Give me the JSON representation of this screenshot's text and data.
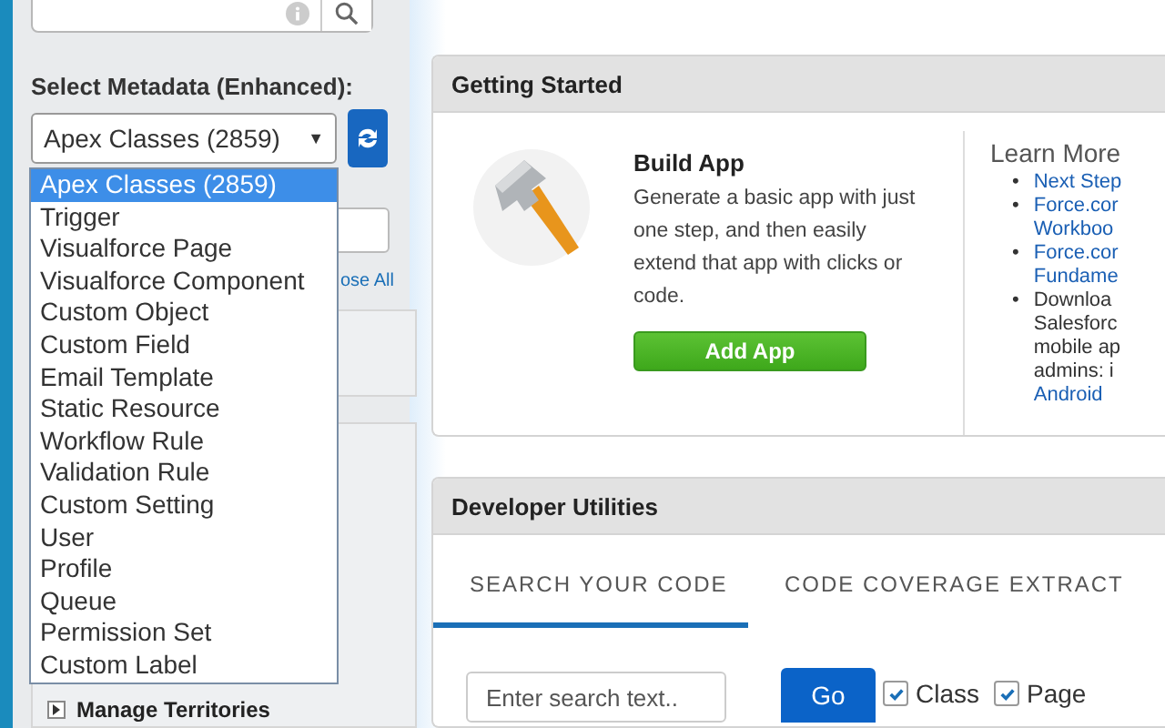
{
  "sidebar": {
    "metadata_label": "Select Metadata (Enhanced):",
    "select": {
      "value": "Apex Classes (2859)",
      "caret": "▼",
      "expanded": true,
      "options": [
        {
          "label": "Apex Classes (2859)",
          "selected": true
        },
        {
          "label": "Trigger",
          "selected": false
        },
        {
          "label": "Visualforce Page",
          "selected": false
        },
        {
          "label": "Visualforce Component",
          "selected": false
        },
        {
          "label": "Custom Object",
          "selected": false
        },
        {
          "label": "Custom Field",
          "selected": false
        },
        {
          "label": "Email Template",
          "selected": false
        },
        {
          "label": "Static Resource",
          "selected": false
        },
        {
          "label": "Workflow Rule",
          "selected": false
        },
        {
          "label": "Validation Rule",
          "selected": false
        },
        {
          "label": "Custom Setting",
          "selected": false
        },
        {
          "label": "User",
          "selected": false
        },
        {
          "label": "Profile",
          "selected": false
        },
        {
          "label": "Queue",
          "selected": false
        },
        {
          "label": "Permission Set",
          "selected": false
        },
        {
          "label": "Custom Label",
          "selected": false
        }
      ]
    },
    "collapse_link": "ose All",
    "tree": [
      {
        "label": "Manage Territories"
      }
    ]
  },
  "getting_started": {
    "title": "Getting Started",
    "build_title": "Build App",
    "build_text": "Generate a basic app with just one step, and then easily extend that app with clicks or code.",
    "button": "Add App",
    "learn_more": "Learn More",
    "links": [
      {
        "bullet": "•",
        "lines": [
          "Next Step"
        ],
        "kind": "link"
      },
      {
        "bullet": "•",
        "lines": [
          "Force.cor",
          "Workboo"
        ],
        "kind": "link"
      },
      {
        "bullet": "•",
        "lines": [
          "Force.cor",
          "Fundame"
        ],
        "kind": "link"
      },
      {
        "bullet": "•",
        "lines": [
          "Downloa",
          "Salesforc",
          "mobile ap",
          "admins: i",
          "Android"
        ],
        "kind": "mixed"
      }
    ]
  },
  "developer_utilities": {
    "title": "Developer Utilities",
    "tabs": [
      {
        "label": "SEARCH YOUR CODE",
        "selected": true
      },
      {
        "label": "CODE COVERAGE EXTRACT",
        "selected": false
      }
    ],
    "search": {
      "placeholder": "Enter search text.."
    },
    "go": "Go",
    "filters": [
      {
        "label": "Class",
        "checked": true
      },
      {
        "label": "Page",
        "checked": true
      }
    ]
  }
}
